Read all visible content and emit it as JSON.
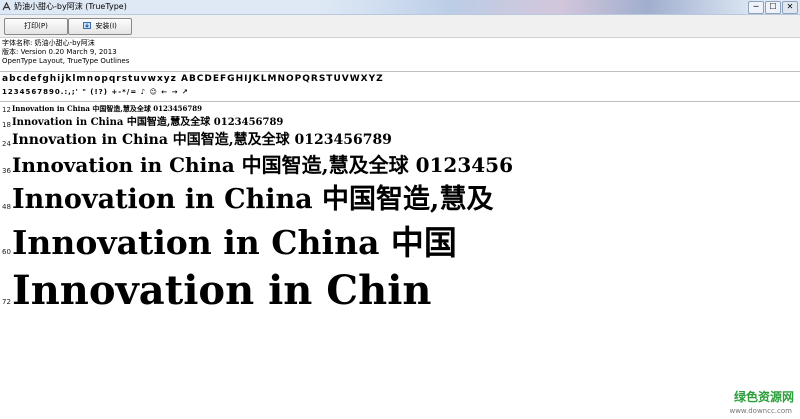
{
  "window": {
    "title": "奶油小甜心-by阿沫 (TrueType)",
    "minimize": "─",
    "maximize": "☐",
    "close": "✕"
  },
  "toolbar": {
    "print_label": "打印(P)",
    "install_label": "安装(I)"
  },
  "font_info": {
    "name_line": "字体名称: 奶油小甜心-by阿沫",
    "version_line": "版本: Version 0.20 March 9, 2013",
    "type_line": "OpenType Layout, TrueType Outlines"
  },
  "charset": {
    "line1": "abcdefghijklmnopqrstuvwxyz ABCDEFGHIJKLMNOPQRSTUVWXYZ",
    "line2": "1234567890.:,;' \" (!?) +-*/=",
    "line2_extra": "♪ ☺ ← → ↗"
  },
  "samples": [
    {
      "size": "12",
      "text": "Innovation in China 中国智造,慧及全球 0123456789"
    },
    {
      "size": "18",
      "text": "Innovation in China 中国智造,慧及全球 0123456789"
    },
    {
      "size": "24",
      "text": "Innovation in China 中国智造,慧及全球 0123456789"
    },
    {
      "size": "36",
      "text": "Innovation in China 中国智造,慧及全球 0123456"
    },
    {
      "size": "48",
      "text": "Innovation in China 中国智造,慧及"
    },
    {
      "size": "60",
      "text": "Innovation in China 中国"
    },
    {
      "size": "72",
      "text": "Innovation in Chin"
    }
  ],
  "watermark": {
    "brand": "绿色资源网",
    "url": "www.downcc.com"
  }
}
